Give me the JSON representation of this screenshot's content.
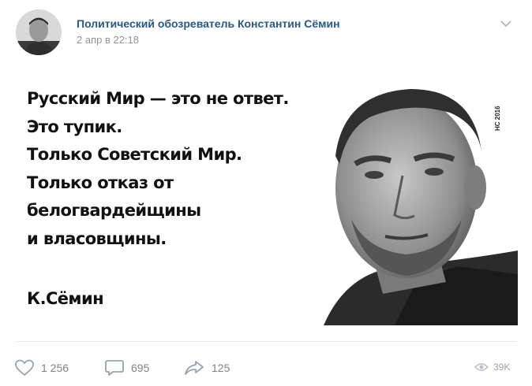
{
  "post": {
    "author": "Политический обозреватель Константин Сёмин",
    "date": "2 апр в 22:18"
  },
  "image": {
    "quote_lines": [
      "Русский Мир — это не ответ.",
      "Это тупик.",
      "Только Советский Мир.",
      "Только отказ от",
      "белогвардейщины",
      "и власовщины."
    ],
    "signature": "К.Сёмин",
    "watermark": "НС 2016"
  },
  "actions": {
    "likes": "1 256",
    "comments": "695",
    "shares": "125",
    "views": "39K"
  },
  "icons": {
    "like": "heart-icon",
    "comment": "comment-icon",
    "share": "share-arrow-icon",
    "views": "eye-icon",
    "more": "chevron-down-icon"
  },
  "colors": {
    "author_link": "#2a5885",
    "meta_gray": "#939393",
    "icon_gray": "#99a2ad"
  }
}
